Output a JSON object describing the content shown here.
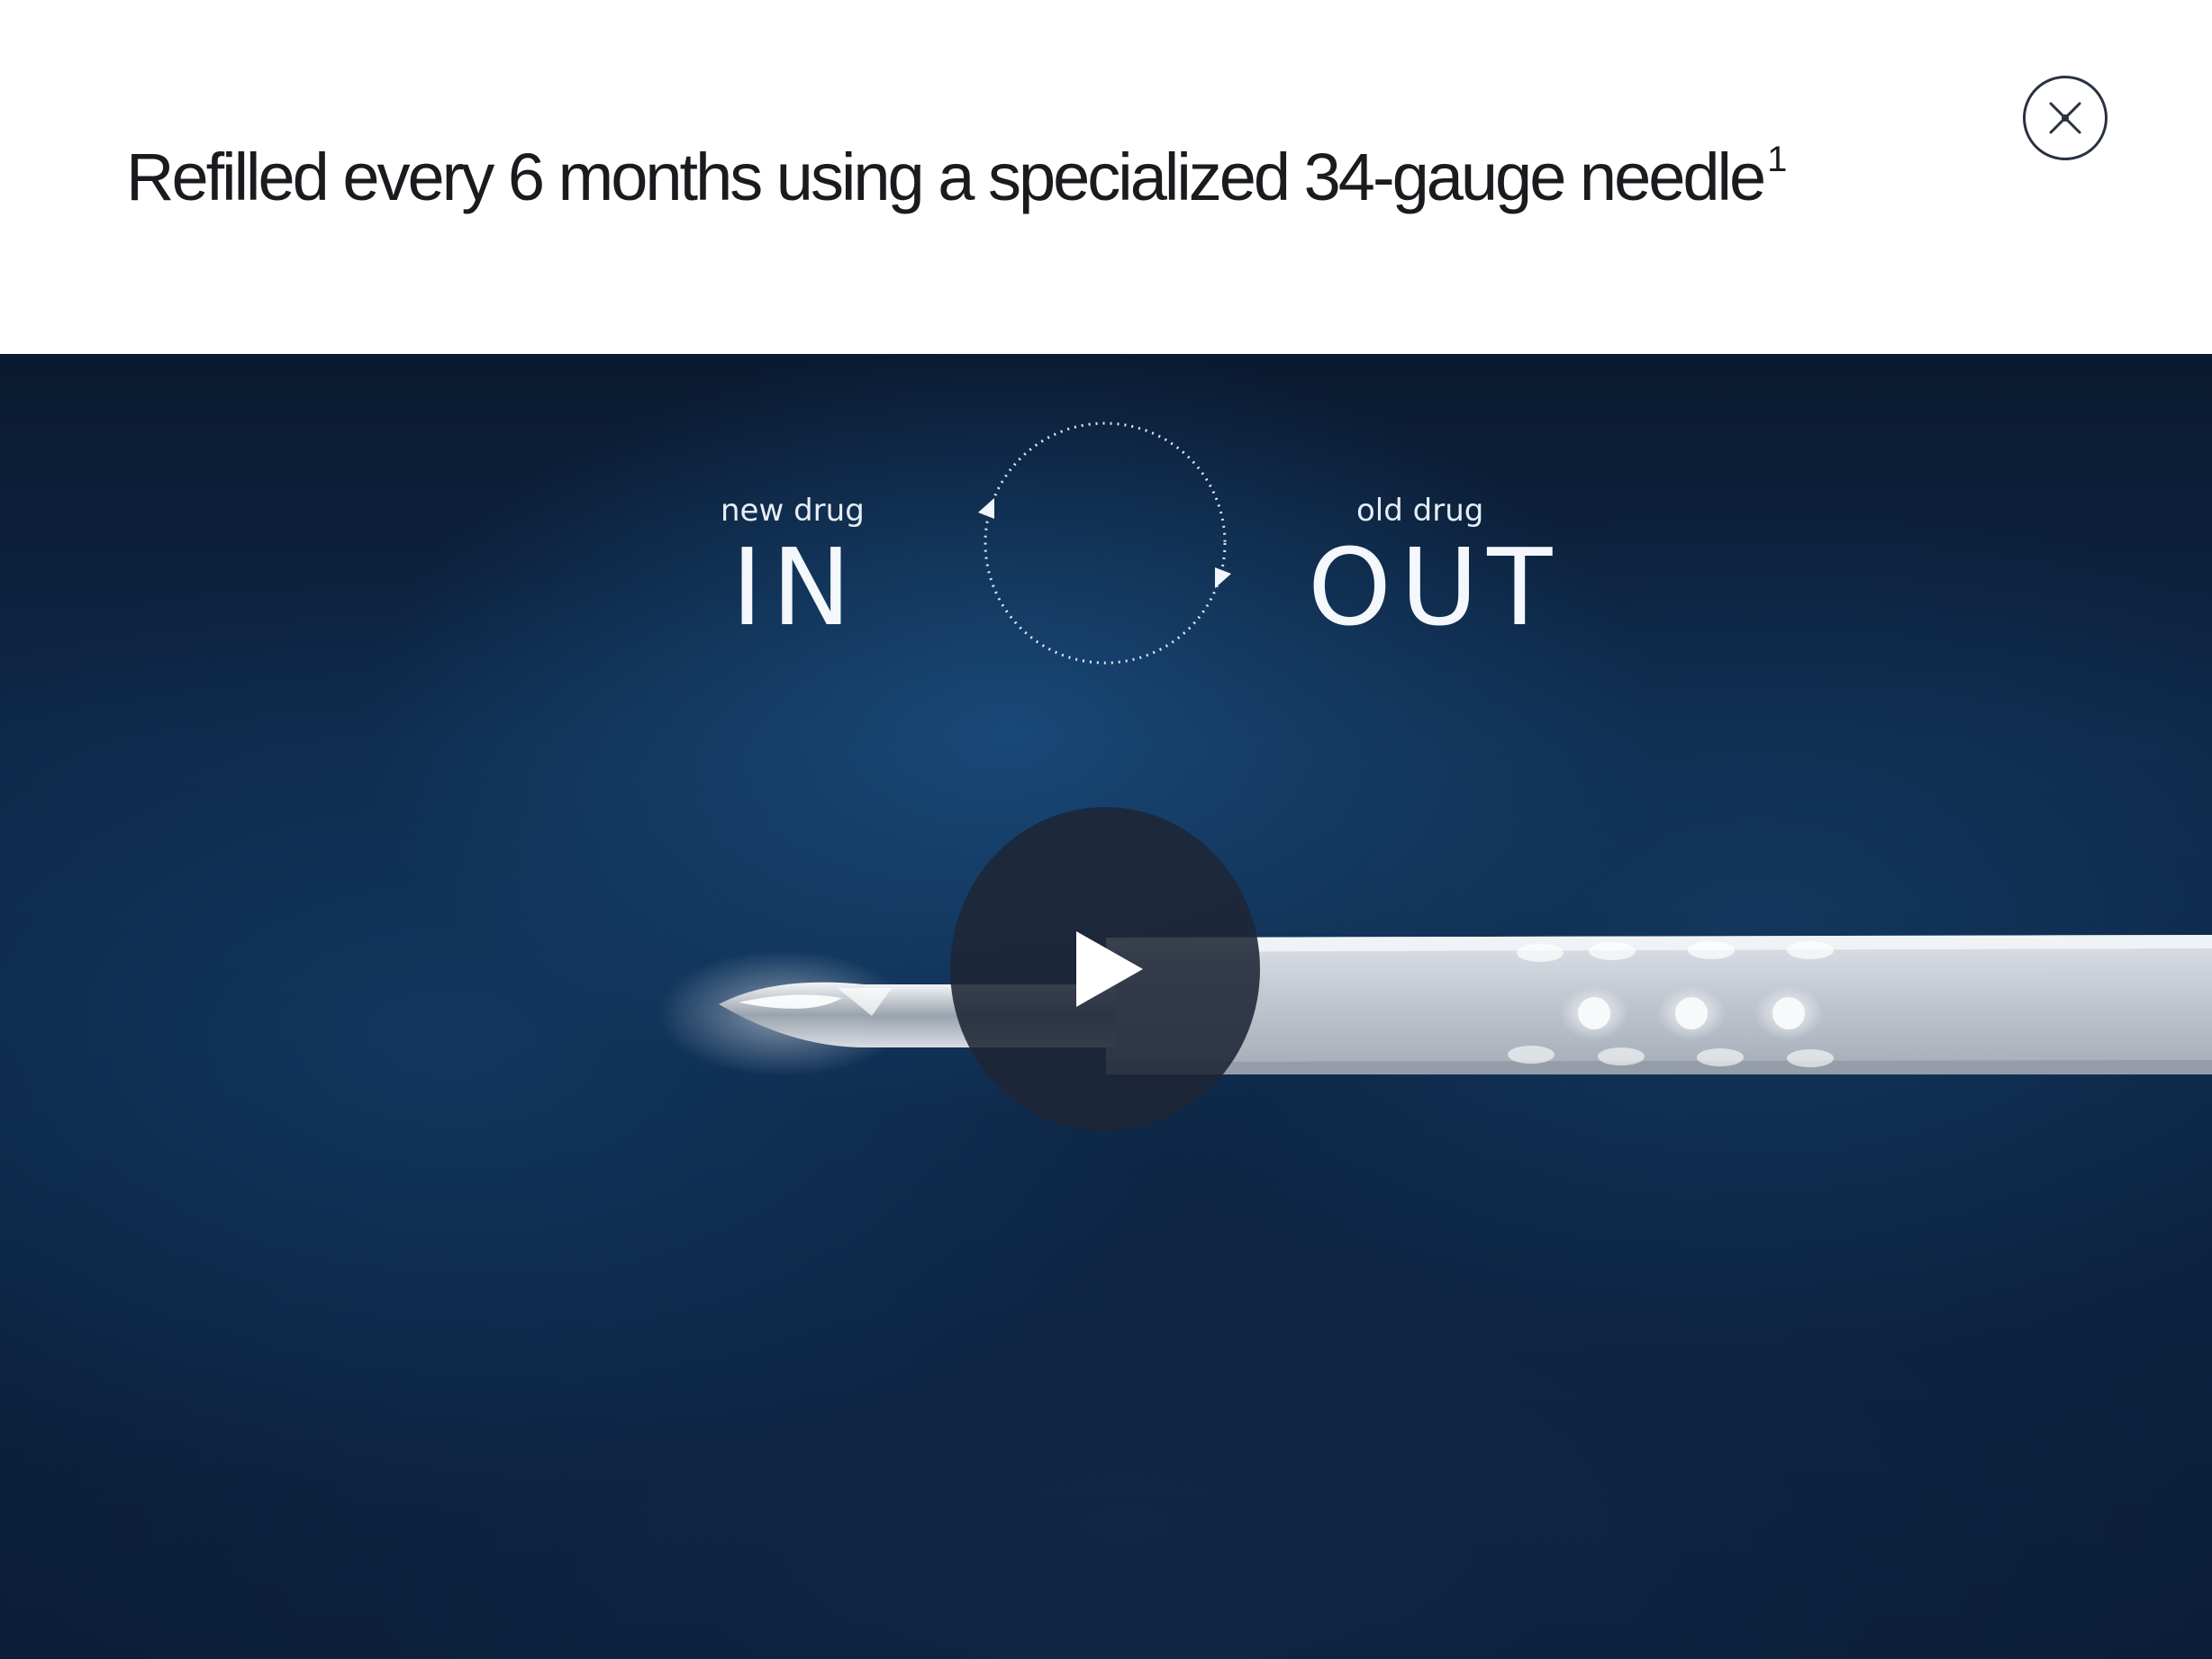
{
  "modal": {
    "title": "Refilled every 6 months using a specialized 34-gauge needle",
    "title_footnote": "1",
    "close_icon": "close-icon"
  },
  "video": {
    "caption_left_small": "new drug",
    "caption_left_big": "IN",
    "caption_right_small": "old drug",
    "caption_right_big": "OUT",
    "cycle_icon": "refresh-cycle-icon",
    "play_icon": "play-icon"
  },
  "colors": {
    "title_text": "#1b1b1f",
    "close_stroke": "#2a3140",
    "video_bg": "#0e2746",
    "play_button_bg": "#1e2636",
    "caption_text": "#f4f7fb"
  }
}
